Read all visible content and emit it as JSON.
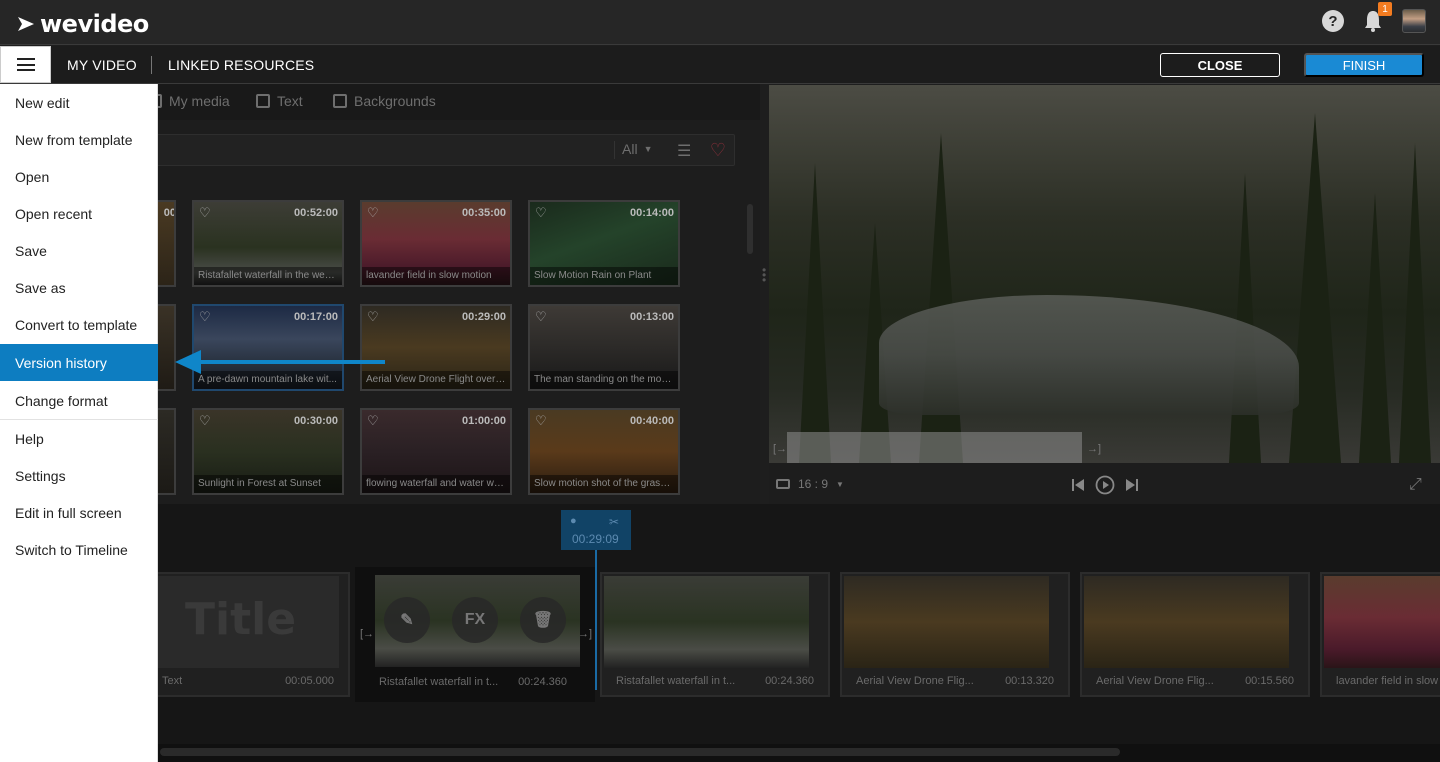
{
  "app": {
    "logo_text": "wevideo",
    "notification_count": "1"
  },
  "nav": {
    "my_video": "MY VIDEO",
    "linked_resources": "LINKED RESOURCES",
    "close_label": "CLOSE",
    "finish_label": "FINISH"
  },
  "media_tabs": [
    {
      "label": "My media",
      "icon": "film-icon"
    },
    {
      "label": "Text",
      "icon": "text-icon"
    },
    {
      "label": "Backgrounds",
      "icon": "image-icon"
    }
  ],
  "media_filter": {
    "selected": "All"
  },
  "media_items": [
    {
      "title": "",
      "duration": "00"
    },
    {
      "title": "Ristafallet waterfall in the west...",
      "duration": "00:52:00"
    },
    {
      "title": "lavander field in slow motion",
      "duration": "00:35:00"
    },
    {
      "title": "Slow Motion Rain on Plant",
      "duration": "00:14:00"
    },
    {
      "title": "",
      "duration": ""
    },
    {
      "title": "A pre-dawn mountain lake wit...",
      "duration": "00:17:00"
    },
    {
      "title": "Aerial View Drone Flight over f...",
      "duration": "00:29:00"
    },
    {
      "title": "The man standing on the moun...",
      "duration": "00:13:00"
    },
    {
      "title": "",
      "duration": ""
    },
    {
      "title": "Sunlight in Forest at Sunset",
      "duration": "00:30:00"
    },
    {
      "title": "flowing waterfall and water wa...",
      "duration": "01:00:00"
    },
    {
      "title": "Slow motion shot of the grass s...",
      "duration": "00:40:00"
    }
  ],
  "preview": {
    "aspect_ratio": "16 : 9"
  },
  "timeline": {
    "playhead_time": "00:29:09",
    "clips": [
      {
        "title": "Text",
        "duration": "00:05.000",
        "title_text": "Title"
      },
      {
        "title": "Ristafallet waterfall in t...",
        "duration": "00:24.360"
      },
      {
        "title": "Ristafallet waterfall in t...",
        "duration": "00:24.360"
      },
      {
        "title": "Aerial View Drone Flig...",
        "duration": "00:13.320"
      },
      {
        "title": "Aerial View Drone Flig...",
        "duration": "00:15.560"
      },
      {
        "title": "lavander field in slow",
        "duration": ""
      }
    ],
    "clip_tools": [
      "pencil-icon",
      "FX",
      "trash-icon"
    ]
  },
  "menu": {
    "items": [
      "New edit",
      "New from template",
      "Open",
      "Open recent",
      "Save",
      "Save as",
      "Convert to template",
      "Version history",
      "Change format",
      "Help",
      "Settings",
      "Edit in full screen",
      "Switch to Timeline"
    ],
    "active": "Version history"
  },
  "colors": {
    "accent": "#1a8ad4",
    "menu_active": "#0d7dc1",
    "badge": "#f47c20",
    "arrow": "#0f86c9"
  }
}
